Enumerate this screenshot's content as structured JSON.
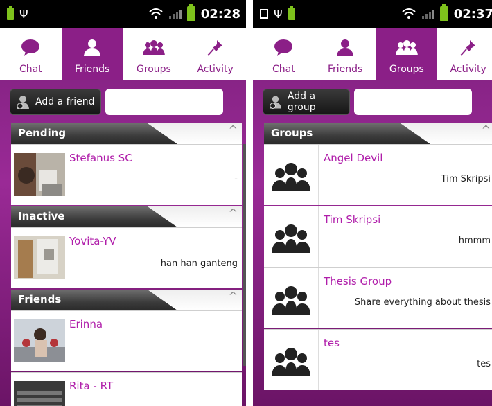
{
  "left": {
    "status_bar": {
      "time": "02:28"
    },
    "tabs": [
      {
        "label": "Chat",
        "icon": "chat-bubble-icon"
      },
      {
        "label": "Friends",
        "icon": "person-icon",
        "active": true
      },
      {
        "label": "Groups",
        "icon": "group-icon"
      },
      {
        "label": "Activity",
        "icon": "pin-icon"
      }
    ],
    "add": {
      "label": "Add a friend",
      "value": "",
      "placeholder": ""
    },
    "sections": {
      "pending": {
        "title": "Pending"
      },
      "inactive": {
        "title": "Inactive"
      },
      "friends": {
        "title": "Friends"
      }
    },
    "items": {
      "pending_1": {
        "name": "Stefanus SC",
        "status": "-"
      },
      "inactive_1": {
        "name": "Yovita-YV",
        "status": "han han ganteng"
      },
      "friends_1": {
        "name": "Erinna",
        "status": ""
      },
      "friends_2": {
        "name": "Rita - RT",
        "status": ""
      }
    }
  },
  "right": {
    "status_bar": {
      "time": "02:37"
    },
    "tabs": [
      {
        "label": "Chat",
        "icon": "chat-bubble-icon"
      },
      {
        "label": "Friends",
        "icon": "person-icon"
      },
      {
        "label": "Groups",
        "icon": "group-icon",
        "active": true
      },
      {
        "label": "Activity",
        "icon": "pin-icon"
      }
    ],
    "add": {
      "label": "Add a group",
      "value": "",
      "placeholder": ""
    },
    "sections": {
      "groups": {
        "title": "Groups"
      }
    },
    "groups": [
      {
        "name": "Angel Devil",
        "status": "Tim Skripsi"
      },
      {
        "name": "Tim Skripsi",
        "status": "hmmm"
      },
      {
        "name": "Thesis Group",
        "status": "Share everything about thesis"
      },
      {
        "name": "tes",
        "status": "tes"
      }
    ]
  },
  "colors": {
    "accent": "#8b1f87",
    "name_text": "#b01eaa",
    "battery": "#7ec21c"
  }
}
